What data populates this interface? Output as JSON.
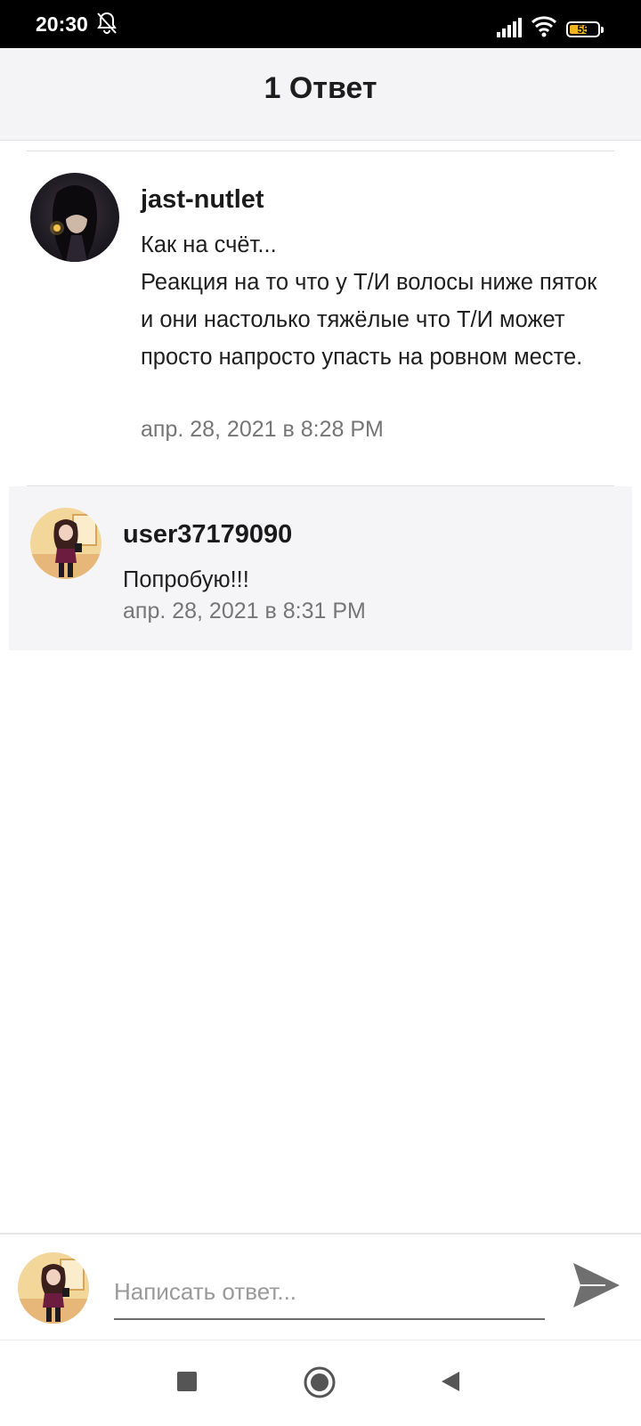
{
  "status_bar": {
    "time": "20:30",
    "battery": "55",
    "icons": [
      "mute-bell-icon",
      "signal-icon",
      "wifi-icon",
      "battery-icon"
    ]
  },
  "header": {
    "title": "1 Ответ"
  },
  "comment": {
    "author": "jast-nutlet",
    "text": "Как на счёт...\nРеакция на то что у Т/И волосы ниже пяток и они настолько тяжёлые что Т/И может просто напросто упасть на ровном месте.",
    "time": "апр. 28, 2021 в 8:28 PM"
  },
  "reply": {
    "author": "user37179090",
    "text": "Попробую!!!",
    "time": "апр. 28, 2021 в 8:31 PM"
  },
  "compose": {
    "placeholder": "Написать ответ...",
    "send_icon": "send-icon"
  },
  "navigation": {
    "icons": [
      "recent-apps-icon",
      "home-icon",
      "back-icon"
    ]
  },
  "colors": {
    "header_bg": "#f4f3f5",
    "reply_bg": "#f5f4f6",
    "timestamp": "#767676",
    "battery_accent": "#f2b51f"
  }
}
